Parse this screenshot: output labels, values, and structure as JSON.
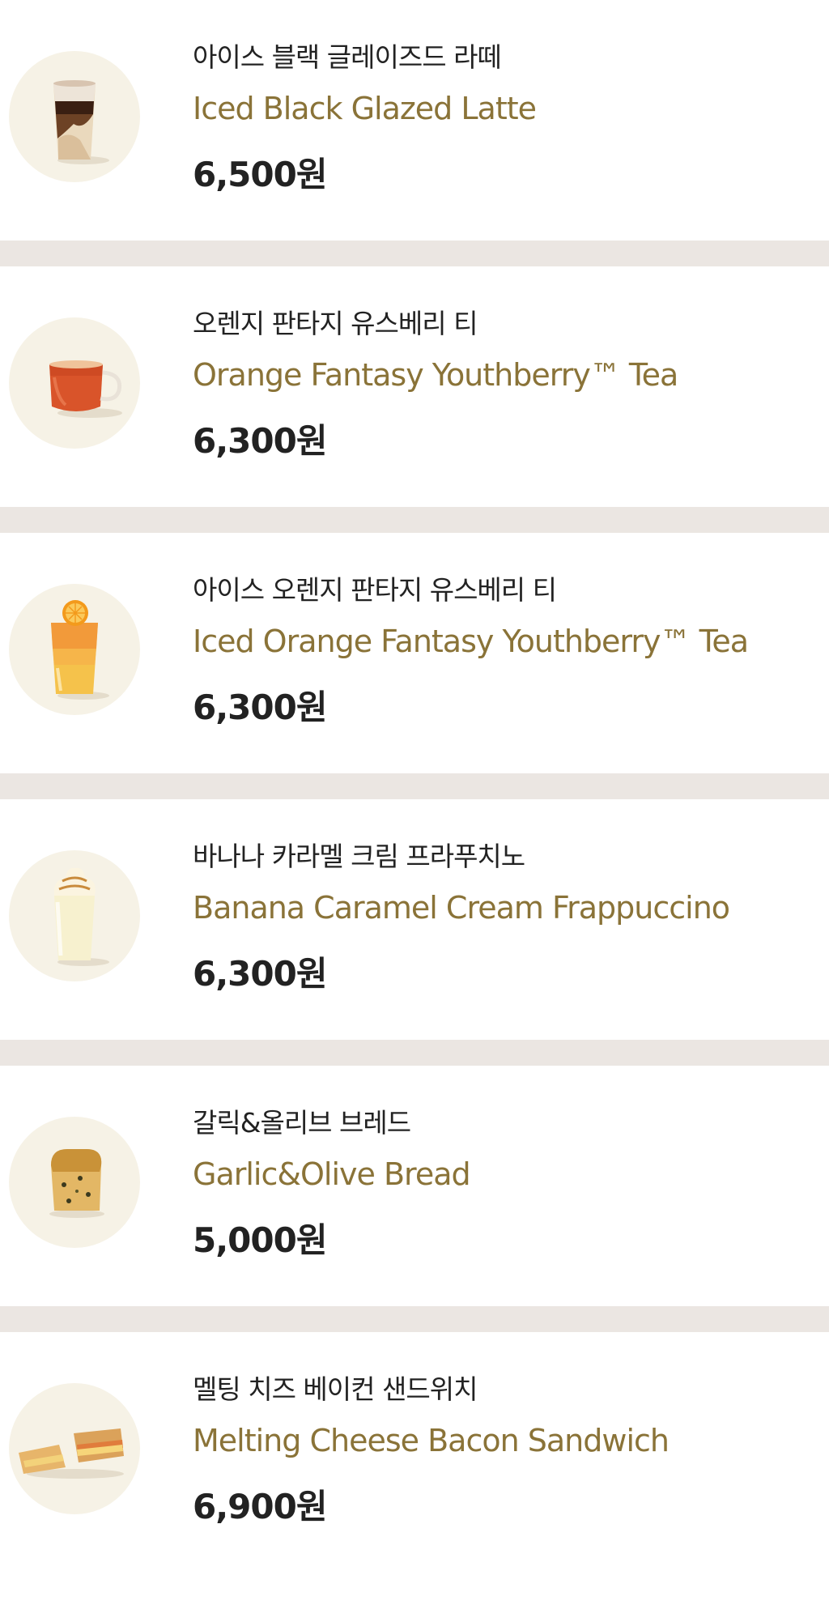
{
  "menu": {
    "items": [
      {
        "name_ko": "아이스 블랙 글레이즈드 라떼",
        "name_en": "Iced Black Glazed Latte",
        "price": "6,500원",
        "image": "iced-latte-image"
      },
      {
        "name_ko": "오렌지 판타지 유스베리 티",
        "name_en": "Orange Fantasy Youthberry™ Tea",
        "price": "6,300원",
        "image": "hot-tea-mug-image"
      },
      {
        "name_ko": "아이스 오렌지 판타지 유스베리 티",
        "name_en": "Iced Orange Fantasy Youthberry™ Tea",
        "price": "6,300원",
        "image": "iced-orange-tea-image"
      },
      {
        "name_ko": "바나나 카라멜 크림 프라푸치노",
        "name_en": "Banana Caramel Cream Frappuccino",
        "price": "6,300원",
        "image": "frappuccino-image"
      },
      {
        "name_ko": "갈릭&올리브 브레드",
        "name_en": "Garlic&Olive Bread",
        "price": "5,000원",
        "image": "bread-image"
      },
      {
        "name_ko": "멜팅 치즈 베이컨 샌드위치",
        "name_en": "Melting Cheese Bacon Sandwich",
        "price": "6,900원",
        "image": "sandwich-image"
      }
    ]
  },
  "colors": {
    "english_name": "#8a7338",
    "separator": "#ebe6e2",
    "thumb_bg": "#f6f2e6",
    "text": "#222222"
  }
}
